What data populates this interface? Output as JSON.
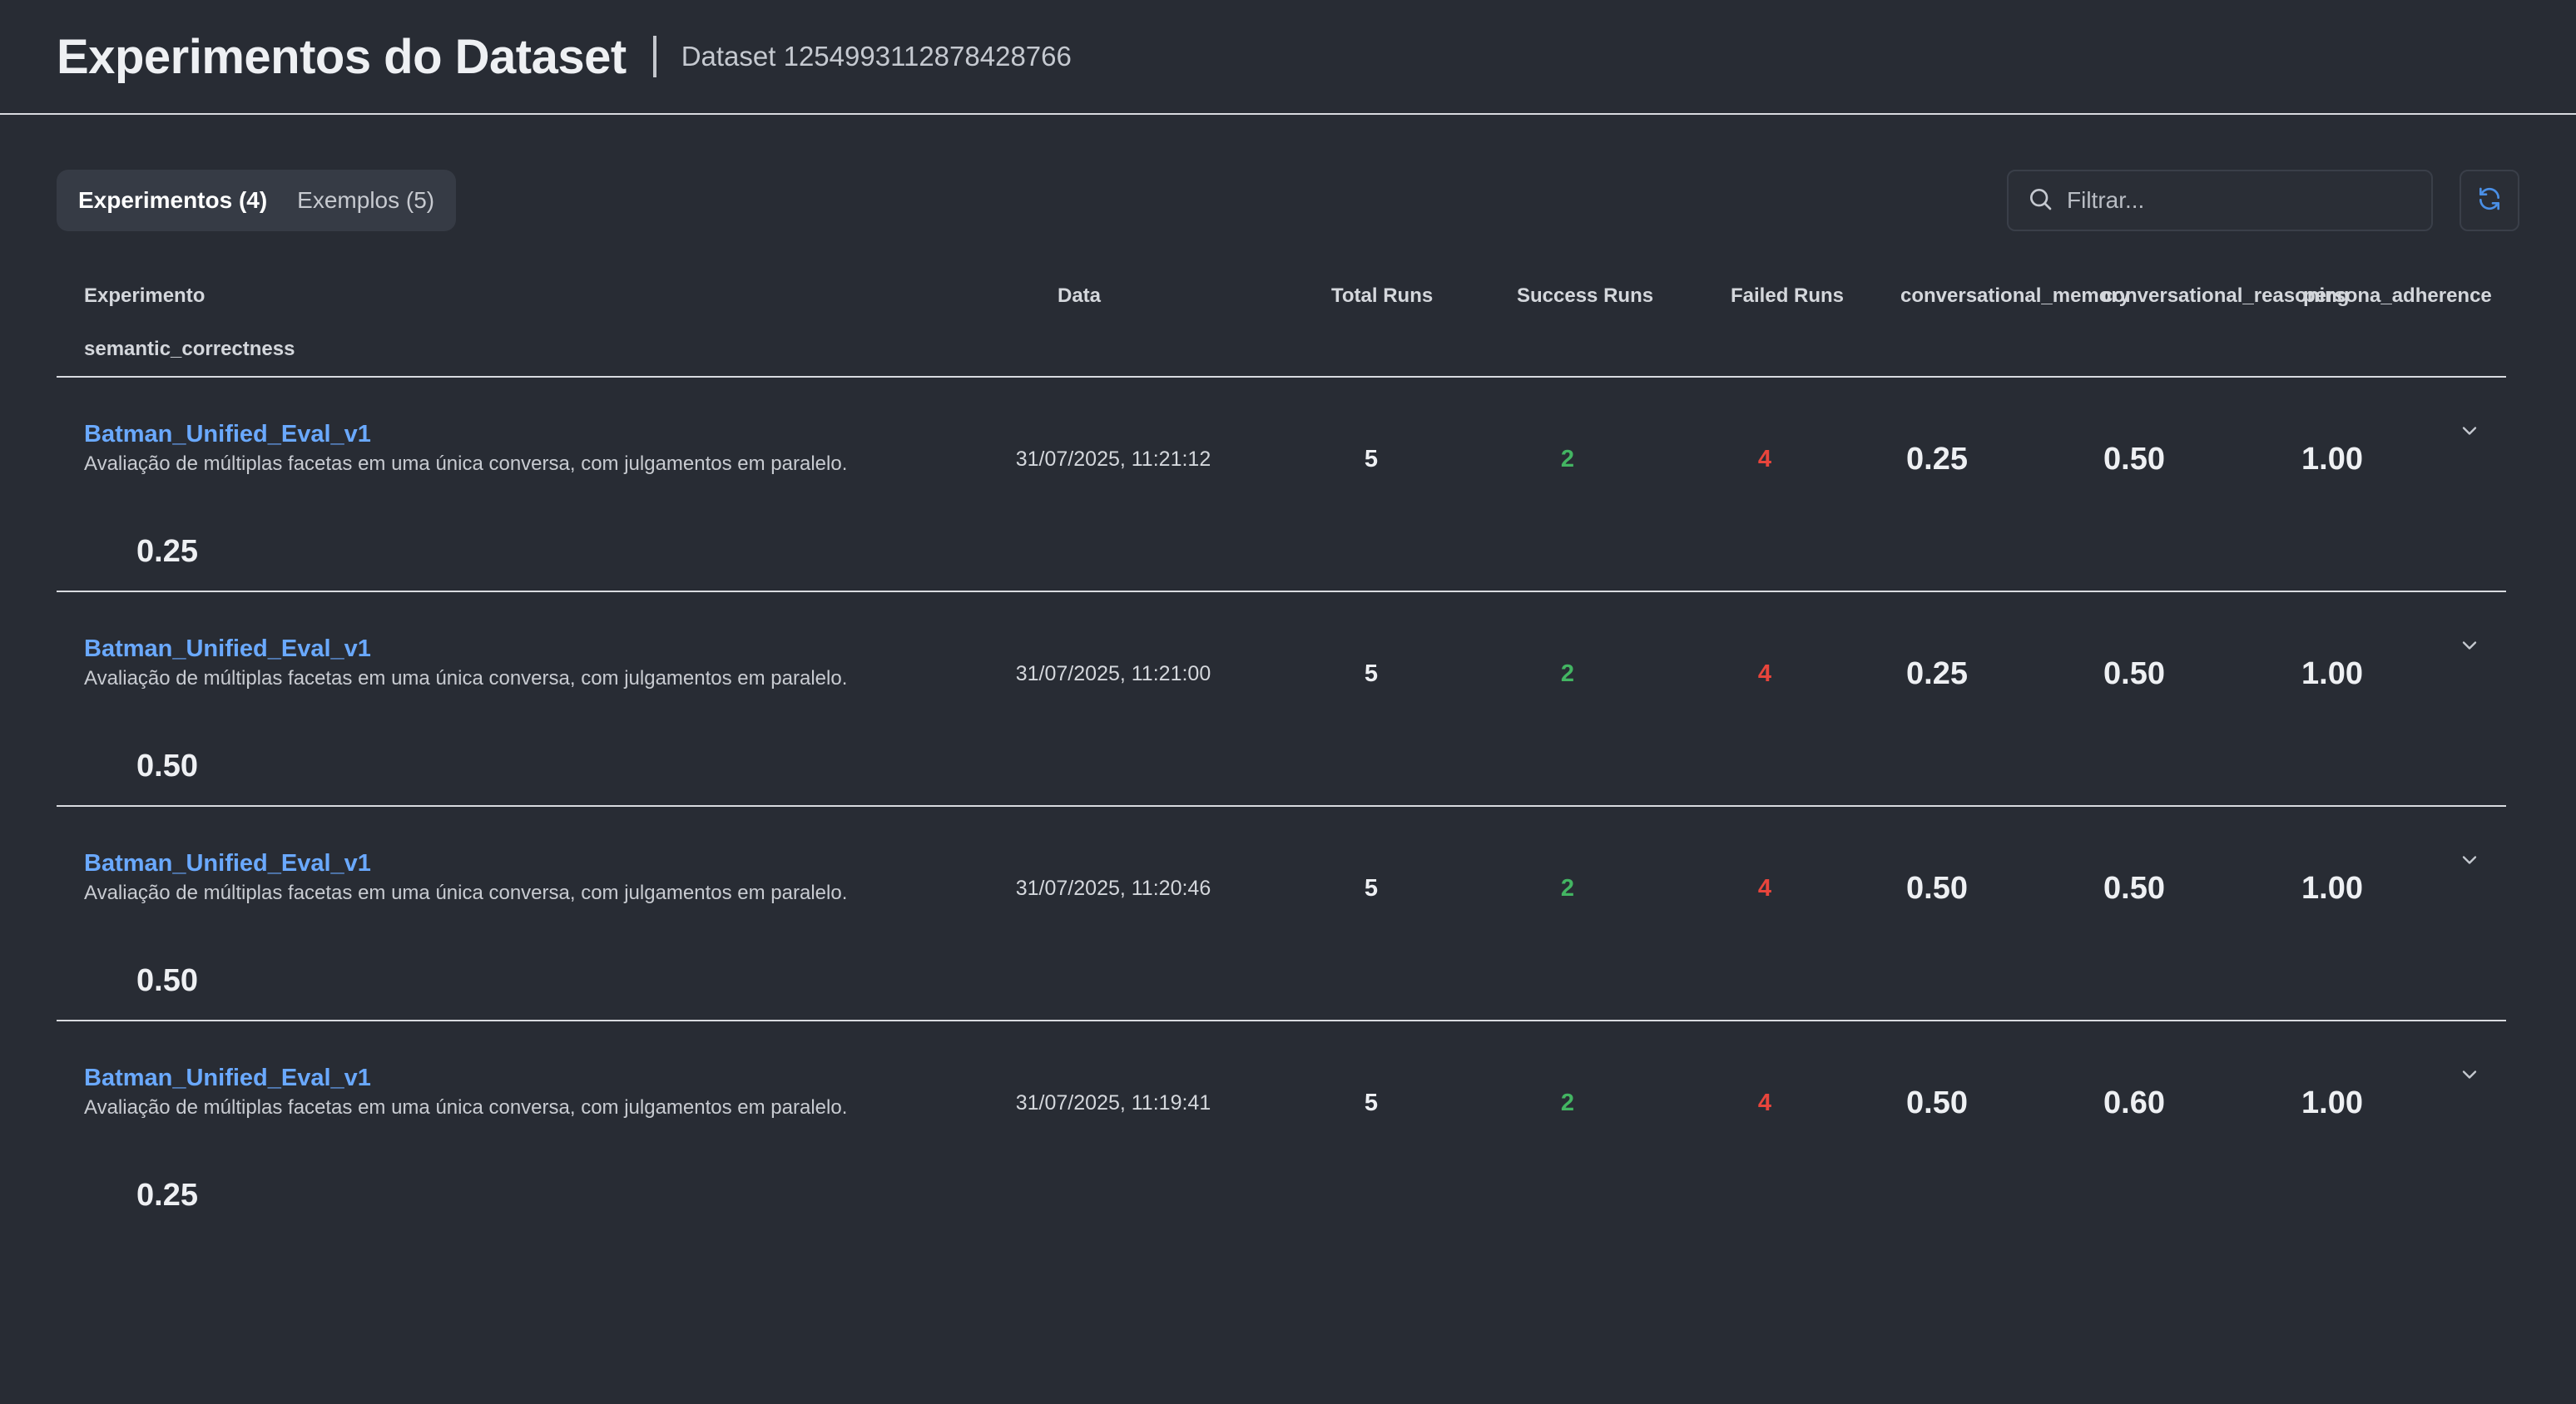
{
  "header": {
    "title": "Experimentos do Dataset",
    "dataset_label": "Dataset 1254993112878428766"
  },
  "tabs": [
    {
      "label": "Experimentos (4)",
      "active": true
    },
    {
      "label": "Exemplos (5)",
      "active": false
    }
  ],
  "filter": {
    "placeholder": "Filtrar...",
    "value": ""
  },
  "icons": {
    "search": "search-icon",
    "refresh": "refresh-icon",
    "expand": "chevron-down-icon"
  },
  "colors": {
    "link": "#6aa9ff",
    "success": "#43b562",
    "failed": "#e8453c",
    "accent": "#4a8fe6"
  },
  "columns": {
    "experiment": "Experimento",
    "date": "Data",
    "total_runs": "Total Runs",
    "success_runs": "Success Runs",
    "failed_runs": "Failed Runs",
    "conversational_memory": "conversational_memory",
    "conversational_reasoning": "conversational_reasoning",
    "persona_adherence": "persona_adherence",
    "semantic_correctness": "semantic_correctness"
  },
  "rows": [
    {
      "name": "Batman_Unified_Eval_v1",
      "description": "Avaliação de múltiplas facetas em uma única conversa, com julgamentos em paralelo.",
      "date": "31/07/2025, 11:21:12",
      "total_runs": "5",
      "success_runs": "2",
      "failed_runs": "4",
      "conversational_memory": "0.25",
      "conversational_reasoning": "0.50",
      "persona_adherence": "1.00",
      "semantic_correctness": "0.25"
    },
    {
      "name": "Batman_Unified_Eval_v1",
      "description": "Avaliação de múltiplas facetas em uma única conversa, com julgamentos em paralelo.",
      "date": "31/07/2025, 11:21:00",
      "total_runs": "5",
      "success_runs": "2",
      "failed_runs": "4",
      "conversational_memory": "0.25",
      "conversational_reasoning": "0.50",
      "persona_adherence": "1.00",
      "semantic_correctness": "0.50"
    },
    {
      "name": "Batman_Unified_Eval_v1",
      "description": "Avaliação de múltiplas facetas em uma única conversa, com julgamentos em paralelo.",
      "date": "31/07/2025, 11:20:46",
      "total_runs": "5",
      "success_runs": "2",
      "failed_runs": "4",
      "conversational_memory": "0.50",
      "conversational_reasoning": "0.50",
      "persona_adherence": "1.00",
      "semantic_correctness": "0.50"
    },
    {
      "name": "Batman_Unified_Eval_v1",
      "description": "Avaliação de múltiplas facetas em uma única conversa, com julgamentos em paralelo.",
      "date": "31/07/2025, 11:19:41",
      "total_runs": "5",
      "success_runs": "2",
      "failed_runs": "4",
      "conversational_memory": "0.50",
      "conversational_reasoning": "0.60",
      "persona_adherence": "1.00",
      "semantic_correctness": "0.25"
    }
  ]
}
